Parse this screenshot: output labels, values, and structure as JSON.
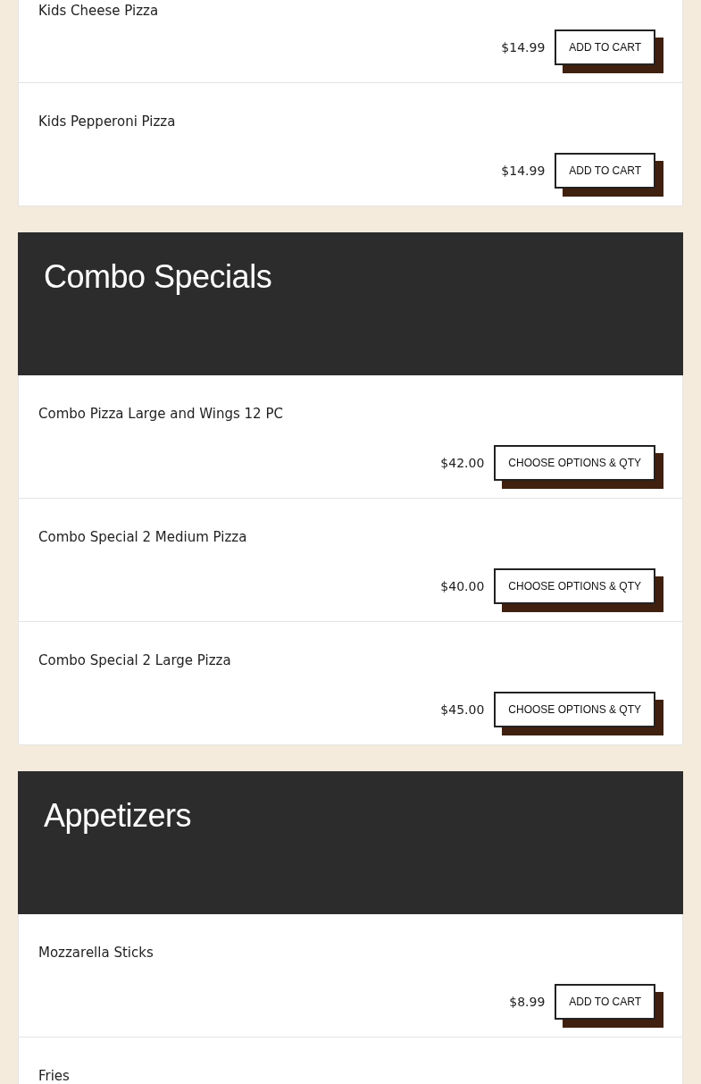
{
  "categories": [
    {
      "items": [
        {
          "name": "Kids Cheese Pizza",
          "price": "$14.99",
          "button": "ADD TO CART"
        },
        {
          "name": "Kids Pepperoni Pizza",
          "price": "$14.99",
          "button": "ADD TO CART"
        }
      ]
    },
    {
      "title": "Combo Specials",
      "items": [
        {
          "name": "Combo Pizza Large and Wings 12 PC",
          "price": "$42.00",
          "button": "CHOOSE OPTIONS & QTY"
        },
        {
          "name": "Combo Special 2 Medium Pizza",
          "price": "$40.00",
          "button": "CHOOSE OPTIONS & QTY"
        },
        {
          "name": "Combo Special 2 Large Pizza",
          "price": "$45.00",
          "button": "CHOOSE OPTIONS & QTY"
        }
      ]
    },
    {
      "title": "Appetizers",
      "items": [
        {
          "name": "Mozzarella Sticks",
          "price": "$8.99",
          "button": "ADD TO CART"
        },
        {
          "name": "Fries"
        }
      ]
    }
  ]
}
